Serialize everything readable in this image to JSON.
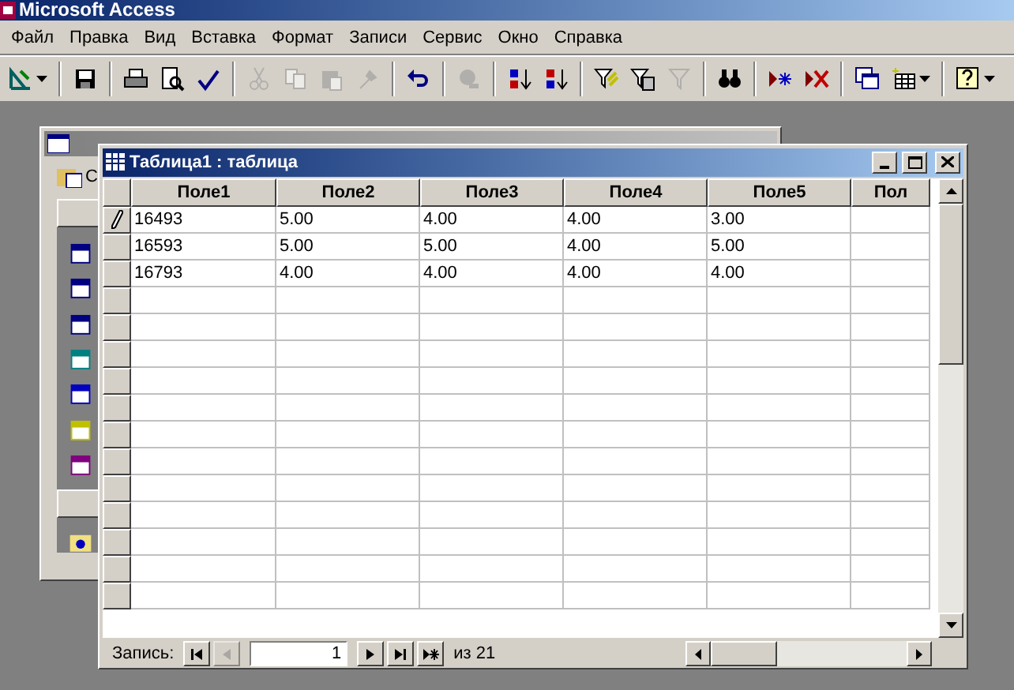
{
  "app_title": "Microsoft Access",
  "menu": [
    "Файл",
    "Правка",
    "Вид",
    "Вставка",
    "Формат",
    "Записи",
    "Сервис",
    "Окно",
    "Справка"
  ],
  "toolbar": [
    {
      "kind": "design",
      "disabled": false,
      "dropdown": true
    },
    {
      "kind": "sep"
    },
    {
      "kind": "save",
      "disabled": false
    },
    {
      "kind": "sep"
    },
    {
      "kind": "print",
      "disabled": false
    },
    {
      "kind": "preview",
      "disabled": false
    },
    {
      "kind": "spelling",
      "disabled": false
    },
    {
      "kind": "sep"
    },
    {
      "kind": "cut",
      "disabled": true
    },
    {
      "kind": "copy",
      "disabled": true
    },
    {
      "kind": "paste",
      "disabled": true
    },
    {
      "kind": "painter",
      "disabled": true
    },
    {
      "kind": "sep"
    },
    {
      "kind": "undo",
      "disabled": false
    },
    {
      "kind": "sep"
    },
    {
      "kind": "link",
      "disabled": true
    },
    {
      "kind": "sep"
    },
    {
      "kind": "sortasc",
      "disabled": false
    },
    {
      "kind": "sortdesc",
      "disabled": false
    },
    {
      "kind": "sep"
    },
    {
      "kind": "filtersel",
      "disabled": false
    },
    {
      "kind": "filterform",
      "disabled": false
    },
    {
      "kind": "filterapply",
      "disabled": true
    },
    {
      "kind": "sep"
    },
    {
      "kind": "find",
      "disabled": false
    },
    {
      "kind": "sep"
    },
    {
      "kind": "newrec",
      "disabled": false
    },
    {
      "kind": "delrec",
      "disabled": false
    },
    {
      "kind": "sep"
    },
    {
      "kind": "dbwin",
      "disabled": false
    },
    {
      "kind": "newobj",
      "disabled": false,
      "dropdown": true
    },
    {
      "kind": "sep"
    },
    {
      "kind": "help",
      "disabled": false,
      "dropdown": true
    }
  ],
  "back_window": {
    "toolbar_label": "С"
  },
  "table_window": {
    "title": "Таблица1 : таблица",
    "columns": [
      "Поле1",
      "Поле2",
      "Поле3",
      "Поле4",
      "Поле5",
      "Пол"
    ],
    "rows": [
      {
        "editing": true,
        "cells": [
          "16493",
          "5.00",
          "4.00",
          "4.00",
          "3.00"
        ]
      },
      {
        "editing": false,
        "cells": [
          "16593",
          "5.00",
          "5.00",
          "4.00",
          "5.00"
        ]
      },
      {
        "editing": false,
        "cells": [
          "16793",
          "4.00",
          "4.00",
          "4.00",
          "4.00"
        ]
      }
    ],
    "nav": {
      "label": "Запись:",
      "current": "1",
      "total": "из 21"
    }
  }
}
